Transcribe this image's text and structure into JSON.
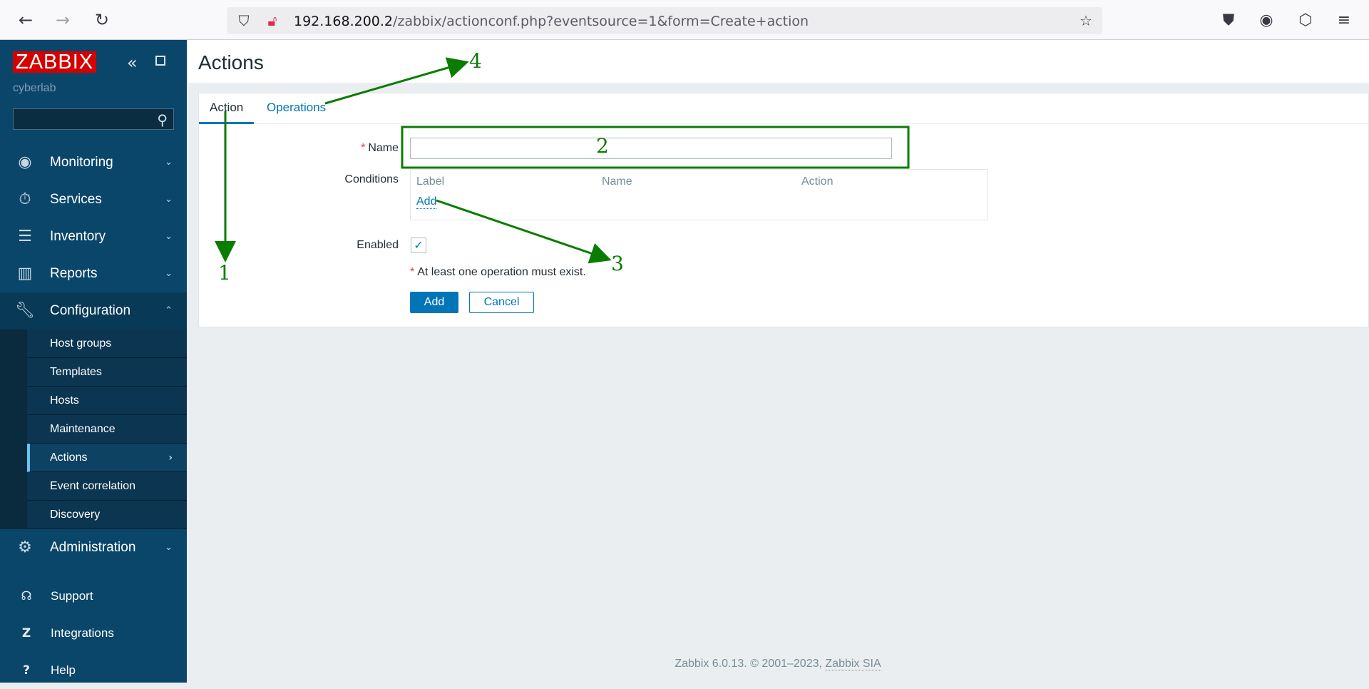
{
  "browser": {
    "url_host": "192.168.200.2",
    "url_path": "/zabbix/actionconf.php?eventsource=1&form=Create+action",
    "icons": [
      "back-icon",
      "forward-icon",
      "reload-icon",
      "shield-icon",
      "insecure-lock-icon",
      "bookmark-star-icon",
      "pocket-icon",
      "account-icon",
      "extensions-icon",
      "menu-icon"
    ]
  },
  "sidebar": {
    "logo": "ZABBIX",
    "server_name": "cyberlab",
    "menu": [
      {
        "label": "Monitoring"
      },
      {
        "label": "Services"
      },
      {
        "label": "Inventory"
      },
      {
        "label": "Reports"
      },
      {
        "label": "Configuration"
      },
      {
        "label": "Administration"
      }
    ],
    "configuration_submenu": [
      {
        "label": "Host groups"
      },
      {
        "label": "Templates"
      },
      {
        "label": "Hosts"
      },
      {
        "label": "Maintenance"
      },
      {
        "label": "Actions"
      },
      {
        "label": "Event correlation"
      },
      {
        "label": "Discovery"
      }
    ],
    "bottom": [
      {
        "label": "Support"
      },
      {
        "label": "Integrations"
      },
      {
        "label": "Help"
      }
    ]
  },
  "page": {
    "title": "Actions",
    "tabs": [
      {
        "label": "Action"
      },
      {
        "label": "Operations"
      }
    ],
    "form": {
      "name_label": "Name",
      "name_value": "",
      "conditions_label": "Conditions",
      "conditions_columns": [
        "Label",
        "Name",
        "Action"
      ],
      "conditions_add": "Add",
      "enabled_label": "Enabled",
      "enabled_checked": true,
      "warning": "At least one operation must exist.",
      "add_button": "Add",
      "cancel_button": "Cancel"
    }
  },
  "footer": {
    "text": "Zabbix 6.0.13. © 2001–2023, ",
    "link": "Zabbix SIA"
  },
  "annotations": {
    "color": "#0a7d00",
    "labels": [
      "1",
      "2",
      "3",
      "4"
    ]
  }
}
